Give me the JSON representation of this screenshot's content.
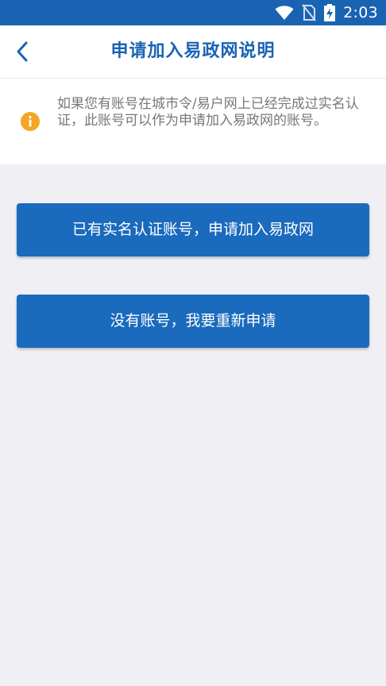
{
  "status_bar": {
    "time": "2:03",
    "icons": [
      "wifi-icon",
      "no-sim-icon",
      "battery-charging-icon"
    ]
  },
  "header": {
    "title": "申请加入易政网说明",
    "back_icon": "chevron-left-icon"
  },
  "notice": {
    "icon": "info-icon",
    "text": "如果您有账号在城市令/易户网上已经完成过实名认证，此账号可以作为申请加入易政网的账号。"
  },
  "actions": {
    "existing_account_label": "已有实名认证账号，申请加入易政网",
    "new_account_label": "没有账号，我要重新申请"
  },
  "colors": {
    "brand": "#1a63b3",
    "button": "#1a6abd",
    "info": "#f5a623",
    "background": "#efeff4"
  }
}
